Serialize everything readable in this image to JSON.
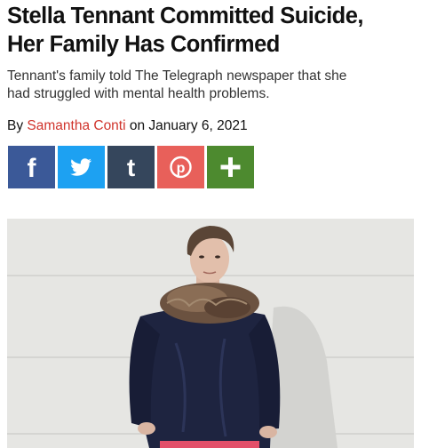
{
  "article": {
    "headline_line1": "Stella Tennant Committed Suicide,",
    "headline_line2": "Her Family Has Confirmed",
    "dek_line1": "Tennant's family told The Telegraph newspaper that she",
    "dek_line2": "had struggled with mental health problems.",
    "byline": {
      "prefix": "By ",
      "author": "Samantha Conti",
      "middle": " on ",
      "date": "January 6, 2021"
    }
  },
  "share": {
    "facebook": {
      "icon": "facebook-icon",
      "color": "#3b5998",
      "glyph": "f"
    },
    "twitter": {
      "icon": "twitter-icon",
      "color": "#1da1f2"
    },
    "tumblr": {
      "icon": "tumblr-icon",
      "color": "#35465c",
      "glyph": "t"
    },
    "pinterest": {
      "icon": "pinterest-icon",
      "color": "#e8605a",
      "glyph": "p"
    },
    "more": {
      "icon": "plus-icon",
      "color": "#4d8a2f",
      "glyph": "+"
    }
  },
  "colors": {
    "author_link": "#d0342c",
    "headline": "#111111"
  }
}
